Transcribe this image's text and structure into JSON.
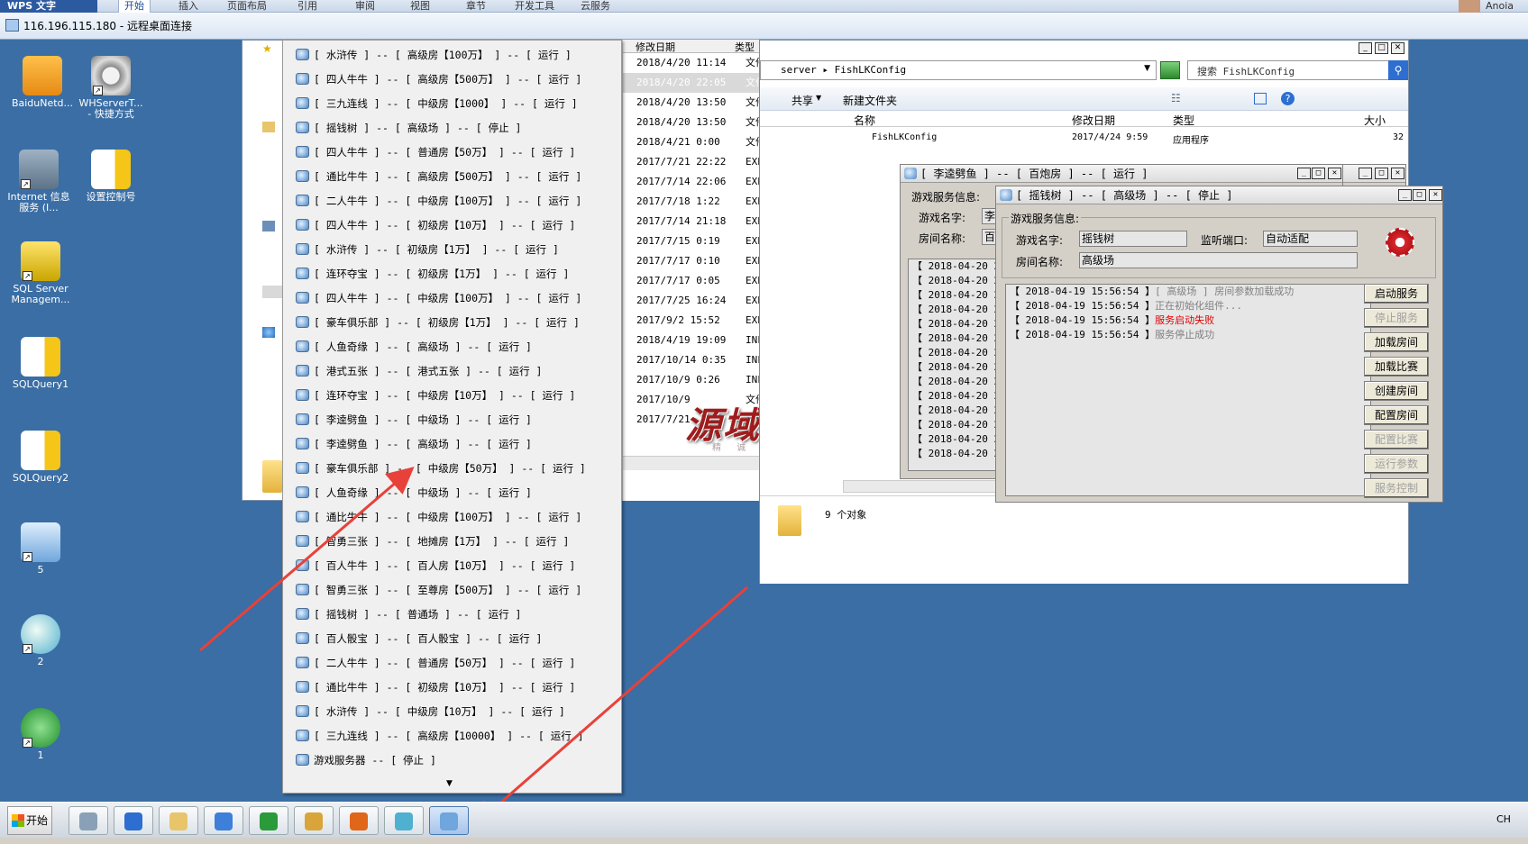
{
  "wps": {
    "logo": "WPS 文字",
    "tabs": [
      "开始",
      "插入",
      "页面布局",
      "引用",
      "审阅",
      "视图",
      "章节",
      "开发工具",
      "云服务"
    ],
    "user": "Anoia"
  },
  "rdp": {
    "title": "116.196.115.180 - 远程桌面连接"
  },
  "desktop_icons": [
    {
      "label": "BaiduNetd...",
      "icon": "baidu-netdisk-icon"
    },
    {
      "label": "WHServerT... - 快捷方式",
      "icon": "gear-shortcut-icon"
    },
    {
      "label": "Internet 信息服务 (I...",
      "icon": "iis-icon"
    },
    {
      "label": "设置控制号",
      "icon": "document-db-icon"
    },
    {
      "label": "SQL Server Managem...",
      "icon": "sql-server-icon"
    },
    {
      "label": "SQLQuery1",
      "icon": "sql-query-icon"
    },
    {
      "label": "SQLQuery2",
      "icon": "sql-query-icon"
    },
    {
      "label": "5",
      "icon": "network-computer-icon"
    },
    {
      "label": "2",
      "icon": "chat-bubble-icon"
    },
    {
      "label": "1",
      "icon": "recycle-arrows-icon"
    }
  ],
  "file_list": {
    "headers": {
      "date": "修改日期",
      "type": "类型",
      "size": "大小"
    },
    "rows": [
      {
        "date": "2018/4/20 11:14",
        "type": "文件夹"
      },
      {
        "date": "2018/4/20 22:05",
        "type": "文件夹"
      },
      {
        "date": "2018/4/20 13:50",
        "type": "文件夹"
      },
      {
        "date": "2018/4/20 13:50",
        "type": "文件夹"
      },
      {
        "date": "2018/4/21 0:00",
        "type": "文件夹"
      },
      {
        "date": "2017/7/21 22:22",
        "type": "EXP 文件"
      },
      {
        "date": "2017/7/14 22:06",
        "type": "EXP 文件"
      },
      {
        "date": "2017/7/18 1:22",
        "type": "EXP 文件"
      },
      {
        "date": "2017/7/14 21:18",
        "type": "EXP 文件"
      },
      {
        "date": "2017/7/15 0:19",
        "type": "EXP 文件"
      },
      {
        "date": "2017/7/17 0:10",
        "type": "EXP 文件"
      },
      {
        "date": "2017/7/17 0:05",
        "type": "EXP 文件"
      },
      {
        "date": "2017/7/25 16:24",
        "type": "EXP 文件"
      },
      {
        "date": "2017/9/2 15:52",
        "type": "EXP 文件"
      },
      {
        "date": "2018/4/19 19:09",
        "type": "INFO 文件"
      },
      {
        "date": "2017/10/14 0:35",
        "type": "INFO 文件"
      },
      {
        "date": "2017/10/9 0:26",
        "type": "INFO 文件"
      },
      {
        "date": "2017/10/9",
        "type": "文件"
      },
      {
        "date": "2017/7/21",
        "type": "文件"
      }
    ]
  },
  "context_menu": {
    "items": [
      "[ 水浒传 ] -- [ 高级房【100万】 ] -- [ 运行 ]",
      "[ 四人牛牛 ] -- [ 高级房【500万】 ] -- [ 运行 ]",
      "[ 三九连线 ] -- [ 中级房【1000】 ] -- [ 运行 ]",
      "[ 摇钱树 ] -- [ 高级场 ] -- [ 停止 ]",
      "[ 四人牛牛 ] -- [ 普通房【50万】 ] -- [ 运行 ]",
      "[ 通比牛牛 ] -- [ 高级房【500万】 ] -- [ 运行 ]",
      "[ 二人牛牛 ] -- [ 中级房【100万】 ] -- [ 运行 ]",
      "[ 四人牛牛 ] -- [ 初级房【10万】 ] -- [ 运行 ]",
      "[ 水浒传 ] -- [ 初级房【1万】 ] -- [ 运行 ]",
      "[ 连环夺宝 ] -- [ 初级房【1万】 ] -- [ 运行 ]",
      "[ 四人牛牛 ] -- [ 中级房【100万】 ] -- [ 运行 ]",
      "[ 豪车俱乐部 ] -- [ 初级房【1万】 ] -- [ 运行 ]",
      "[ 人鱼奇缘 ] -- [ 高级场 ] -- [ 运行 ]",
      "[ 港式五张 ] -- [ 港式五张 ] -- [ 运行 ]",
      "[ 连环夺宝 ] -- [ 中级房【10万】 ] -- [ 运行 ]",
      "[ 李逵劈鱼 ] -- [ 中级场 ] -- [ 运行 ]",
      "[ 李逵劈鱼 ] -- [ 高级场 ] -- [ 运行 ]",
      "[ 豪车俱乐部 ] -- [ 中级房【50万】 ] -- [ 运行 ]",
      "[ 人鱼奇缘 ] -- [ 中级场 ] -- [ 运行 ]",
      "[ 通比牛牛 ] -- [ 中级房【100万】 ] -- [ 运行 ]",
      "[ 智勇三张 ] -- [ 地摊房【1万】 ] -- [ 运行 ]",
      "[ 百人牛牛 ] -- [ 百人房【10万】 ] -- [ 运行 ]",
      "[ 智勇三张 ] -- [ 至尊房【500万】 ] -- [ 运行 ]",
      "[ 摇钱树 ] -- [ 普通场 ] -- [ 运行 ]",
      "[ 百人骰宝 ] -- [ 百人骰宝 ] -- [ 运行 ]",
      "[ 二人牛牛 ] -- [ 普通房【50万】 ] -- [ 运行 ]",
      "[ 通比牛牛 ] -- [ 初级房【10万】 ] -- [ 运行 ]",
      "[ 水浒传 ] -- [ 中级房【10万】 ] -- [ 运行 ]",
      "[ 三九连线 ] -- [ 高级房【10000】 ] -- [ 运行 ]",
      "游戏服务器 -- [ 停止 ]"
    ],
    "more_arrow": "▼"
  },
  "explorer2": {
    "address": "server ▸ FishLKConfig",
    "search_placeholder": "搜索 FishLKConfig",
    "share": "共享",
    "new_folder": "新建文件夹",
    "col_name": "名称",
    "col_date": "修改日期",
    "col_type": "类型",
    "col_size": "大小",
    "row_name": "FishLKConfig",
    "row_date": "2017/4/24 9:59",
    "row_type": "应用程序",
    "row_size": "32",
    "status": "9 个对象"
  },
  "dialog_fish": {
    "title": "[ 李逵劈鱼 ] -- [ 百炮房 ] -- [ 运行 ]",
    "group": "游戏服务信息:",
    "game_name_label": "游戏名字:",
    "game_name_value": "李",
    "room_name_label": "房间名称:",
    "room_name_value": "百",
    "log_prefix": "【 2018-04-20 22",
    "log_count": 14
  },
  "dialog_back": {
    "buttons": [
      "动服务",
      "止服务",
      "载房间",
      "载比赛",
      "建房间",
      "置房间",
      "置比赛",
      "行参数",
      "务控制"
    ]
  },
  "dialog_main": {
    "title": "[ 摇钱树 ] -- [ 高级场 ] -- [ 停止 ]",
    "group": "游戏服务信息:",
    "game_name_label": "游戏名字:",
    "game_name_value": "摇钱树",
    "port_label": "监听端口:",
    "port_value": "自动适配",
    "room_name_label": "房间名称:",
    "room_name_value": "高级场",
    "logs": [
      {
        "time": "【 2018-04-19 15:56:54 】",
        "msg": "[ 高级场 ] 房间参数加载成功",
        "color": "#808080"
      },
      {
        "time": "【 2018-04-19 15:56:54 】",
        "msg": "正在初始化组件...",
        "color": "#808080"
      },
      {
        "time": "【 2018-04-19 15:56:54 】",
        "msg": "服务启动失败",
        "color": "#e00000"
      },
      {
        "time": "【 2018-04-19 15:56:54 】",
        "msg": "服务停止成功",
        "color": "#808080"
      }
    ],
    "buttons": [
      {
        "label": "启动服务",
        "enabled": true
      },
      {
        "label": "停止服务",
        "enabled": false
      },
      {
        "label": "加载房间",
        "enabled": true
      },
      {
        "label": "加载比赛",
        "enabled": true
      },
      {
        "label": "创建房间",
        "enabled": true
      },
      {
        "label": "配置房间",
        "enabled": true
      },
      {
        "label": "配置比赛",
        "enabled": false
      },
      {
        "label": "运行参数",
        "enabled": false
      },
      {
        "label": "服务控制",
        "enabled": false
      }
    ]
  },
  "watermark": {
    "text": "源域网络",
    "sub": "精 诚 制 作 专 业"
  },
  "taskbar": {
    "start": "开始",
    "lang": "CH",
    "icons": [
      "server-manager-icon",
      "powershell-icon",
      "explorer-folder-icon",
      "baidu-netdisk-icon",
      "recycle-arrows-icon",
      "key-tools-icon",
      "game-vs-icon",
      "chat-bubble-icon",
      "network-computer-icon"
    ]
  },
  "colors": {
    "desktop": "#3a6ea5",
    "arrow": "#e8413a",
    "error": "#e00000"
  }
}
